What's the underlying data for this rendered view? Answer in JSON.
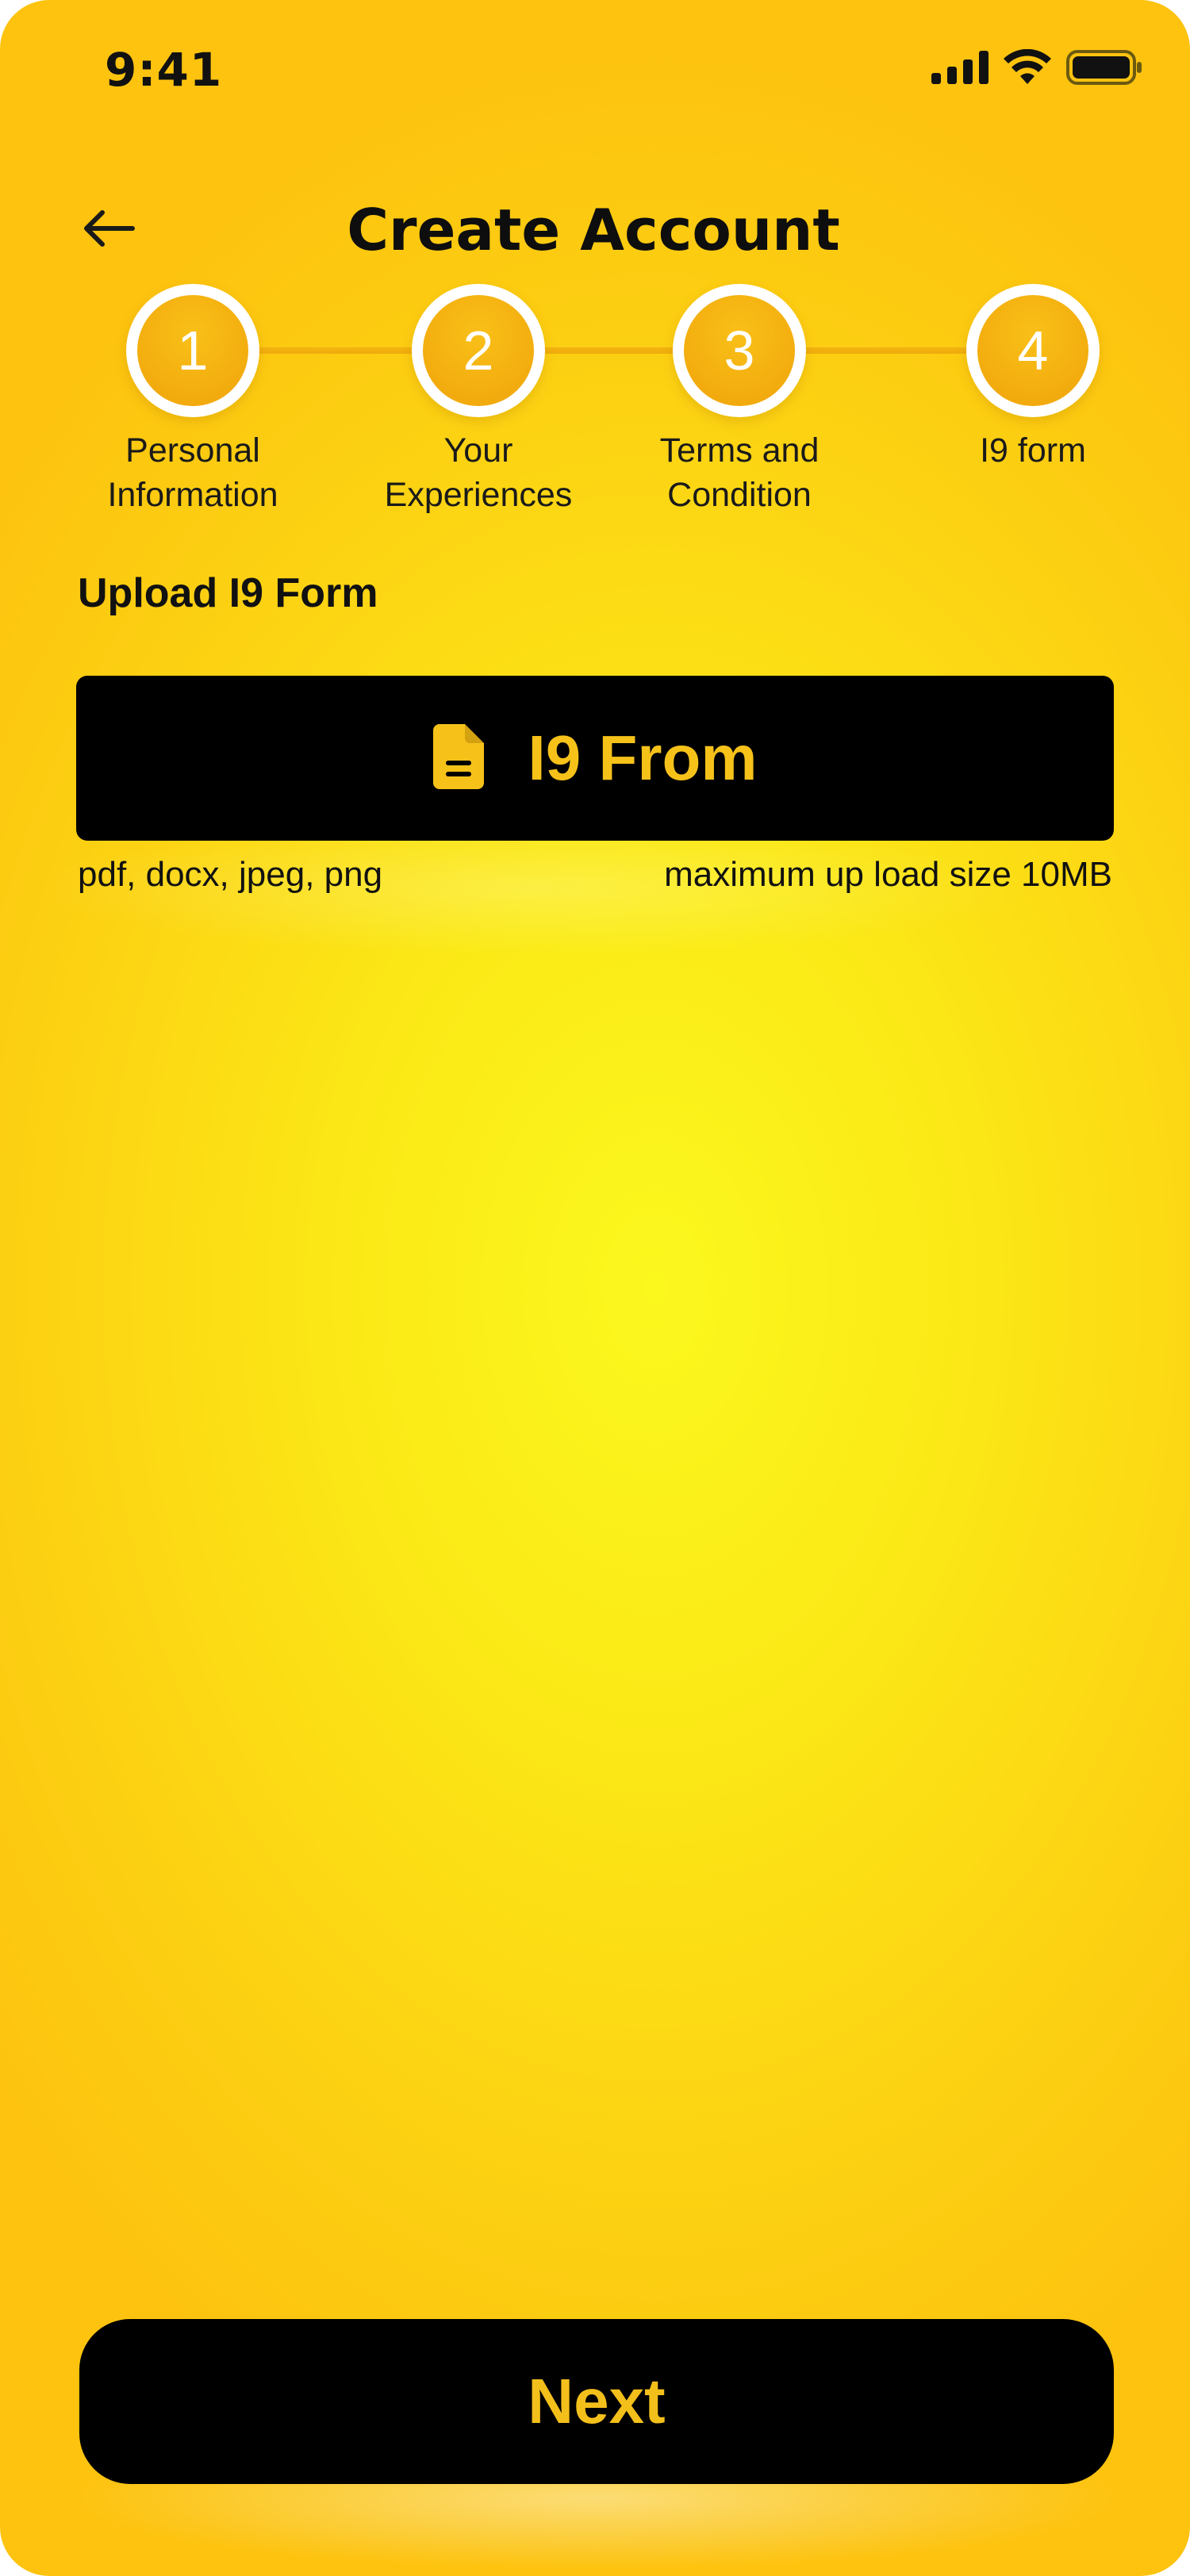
{
  "status_bar": {
    "time": "9:41",
    "icons": [
      "signal-icon",
      "wifi-icon",
      "battery-icon"
    ]
  },
  "header": {
    "title": "Create Account",
    "back_icon": "arrow-left-icon"
  },
  "stepper": {
    "steps": [
      {
        "number": "1",
        "label_line1": "Personal",
        "label_line2": "Information"
      },
      {
        "number": "2",
        "label_line1": "Your",
        "label_line2": "Experiences"
      },
      {
        "number": "3",
        "label_line1": "Terms and",
        "label_line2": "Condition"
      },
      {
        "number": "4",
        "label_line1": "I9 form",
        "label_line2": ""
      }
    ]
  },
  "upload": {
    "section_label": "Upload I9 Form",
    "button_label": "I9 From",
    "button_icon": "document-icon",
    "allowed_types": "pdf, docx, jpeg, png",
    "max_size": "maximum up load size 10MB"
  },
  "footer": {
    "next_label": "Next"
  },
  "colors": {
    "background_center": "#fbf81e",
    "background_edge": "#fdc30f",
    "step_fill": "#f0a30a",
    "button_bg": "#000000",
    "button_text": "#f6c21a"
  }
}
